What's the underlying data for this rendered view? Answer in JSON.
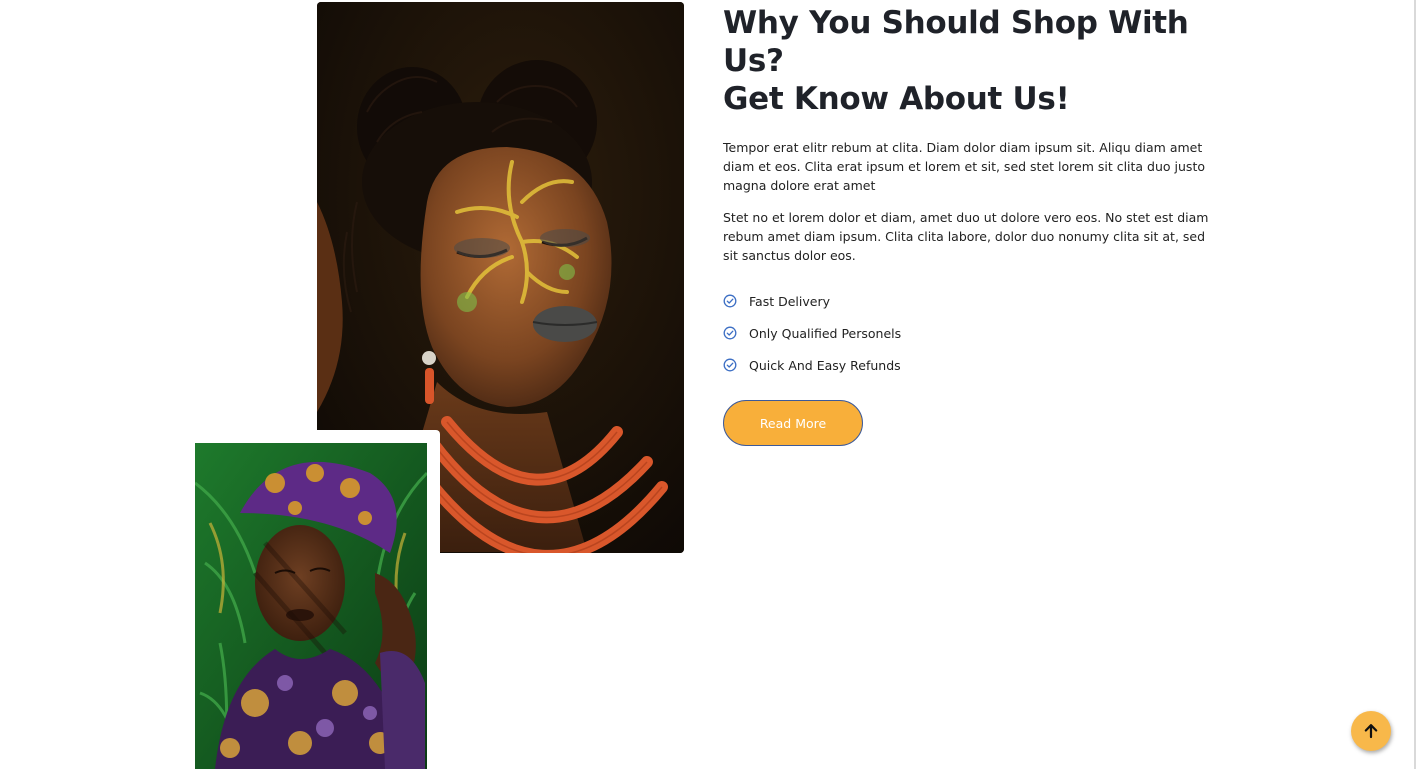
{
  "about": {
    "heading_line1": "Why You Should Shop With Us?",
    "heading_line2": "Get Know About Us!",
    "paragraph1": "Tempor erat elitr rebum at clita. Diam dolor diam ipsum sit. Aliqu diam amet diam et eos. Clita erat ipsum et lorem et sit, sed stet lorem sit clita duo justo magna dolore erat amet",
    "paragraph2": "Stet no et lorem dolor et diam, amet duo ut dolore vero eos. No stet est diam rebum amet diam ipsum. Clita clita labore, dolor duo nonumy clita sit at, sed sit sanctus dolor eos.",
    "features": [
      {
        "label": "Fast Delivery",
        "icon": "check-circle-icon"
      },
      {
        "label": "Only Qualified Personels",
        "icon": "check-circle-icon"
      },
      {
        "label": "Quick And Easy Refunds",
        "icon": "check-circle-icon"
      }
    ],
    "button_label": "Read More"
  },
  "images": {
    "main": "portrait-face-paint-photo",
    "secondary": "portrait-headwrap-photo"
  },
  "back_to_top": {
    "icon": "arrow-up-icon"
  },
  "colors": {
    "accent": "#f8af3a",
    "check": "#3d6fc4",
    "heading": "#1f2229",
    "button_border": "#3d5a99"
  }
}
